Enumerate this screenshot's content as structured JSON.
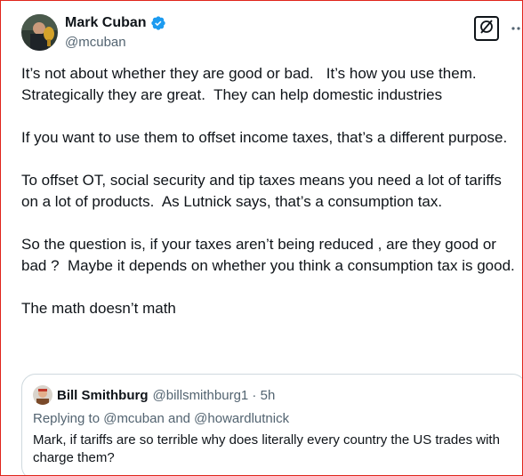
{
  "author": {
    "display_name": "Mark Cuban",
    "handle": "@mcuban"
  },
  "tweet": {
    "paragraphs": [
      "It’s not about whether they are good or bad.   It’s how you use them.  Strategically they are great.  They can help domestic industries",
      "If you want to use them to offset income taxes, that’s a different purpose.",
      "To offset OT, social security and tip taxes means you need a lot of tariffs on a lot of products.  As Lutnick says, that’s a consumption tax.",
      "So the question is, if your taxes aren’t being reduced , are they good or bad ?  Maybe it depends on whether you think a consumption tax is good.",
      "The math doesn’t math"
    ]
  },
  "quote": {
    "display_name": "Bill Smithburg",
    "meta": "@billsmithburg1 · 5h",
    "reply_to": "Replying to @mcuban and @howardlutnick",
    "text": "Mark, if tariffs are so terrible why does literally every country the US trades with charge them?"
  },
  "icons": {
    "verified": "verified-badge-icon",
    "grok": "grok-icon",
    "more": "more-vertical-icon"
  },
  "colors": {
    "accent": "#1d9bf0",
    "border": "#e0241b",
    "text": "#0f1419",
    "secondary": "#536471"
  }
}
